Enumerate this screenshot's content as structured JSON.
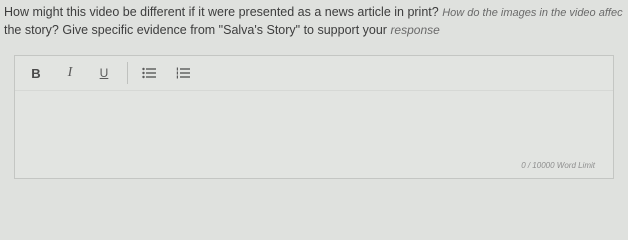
{
  "prompt": {
    "line1_main": "How might this video be different if it were presented as a news article in print? ",
    "line1_italic": "How do the images in the video affec",
    "line2": "the story? Give specific evidence from \"Salva's Story\" to support your ",
    "line2_italic": "response"
  },
  "toolbar": {
    "bold_label": "B",
    "italic_label": "I",
    "underline_label": "U"
  },
  "editor": {
    "word_count": "0 / 10000 Word Limit"
  }
}
